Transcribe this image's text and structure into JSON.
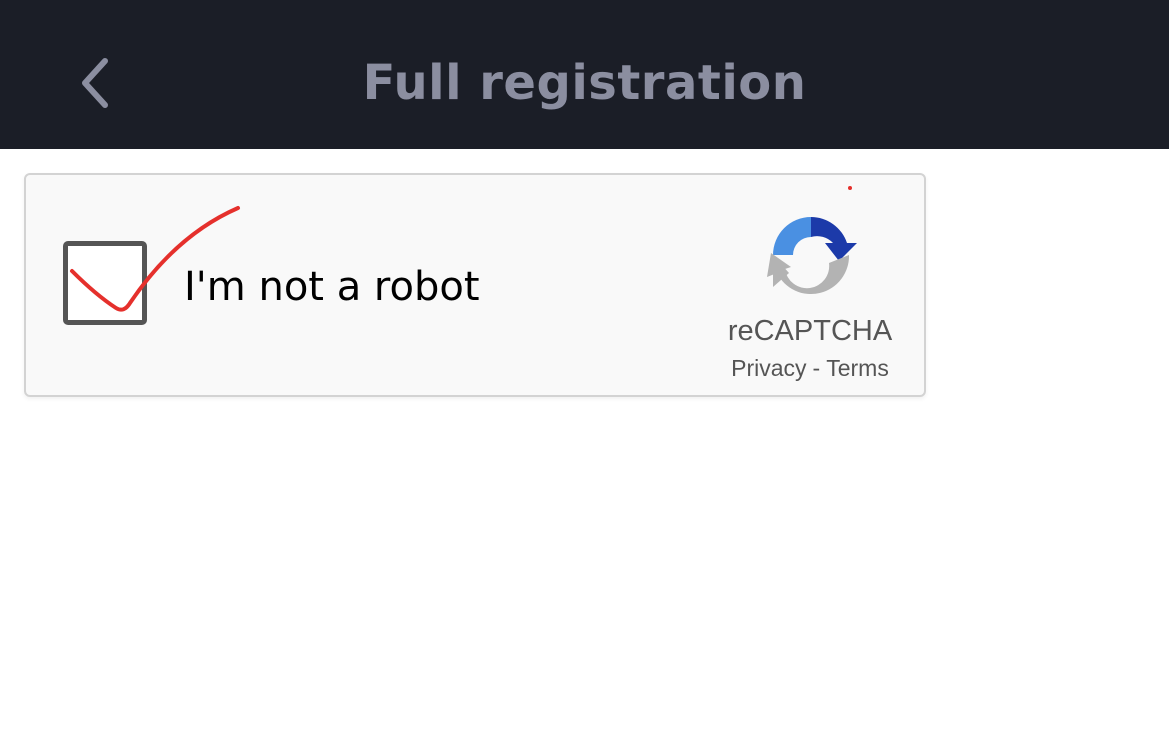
{
  "header": {
    "title": "Full registration",
    "back_icon": "chevron-left-icon"
  },
  "recaptcha": {
    "checkbox_label": "I'm not a robot",
    "checked": false,
    "brand": "reCAPTCHA",
    "privacy_label": "Privacy",
    "separator": "-",
    "terms_label": "Terms",
    "logo_icon": "recaptcha-logo-icon",
    "annotation_icon": "red-checkmark-annotation-icon"
  },
  "colors": {
    "header_bg": "#1b1e27",
    "title": "#8b8ea0",
    "annotation_red": "#e5302c",
    "logo_blue_dark": "#1c3aa9",
    "logo_blue_light": "#4a90e2",
    "logo_gray": "#b3b3b3"
  }
}
